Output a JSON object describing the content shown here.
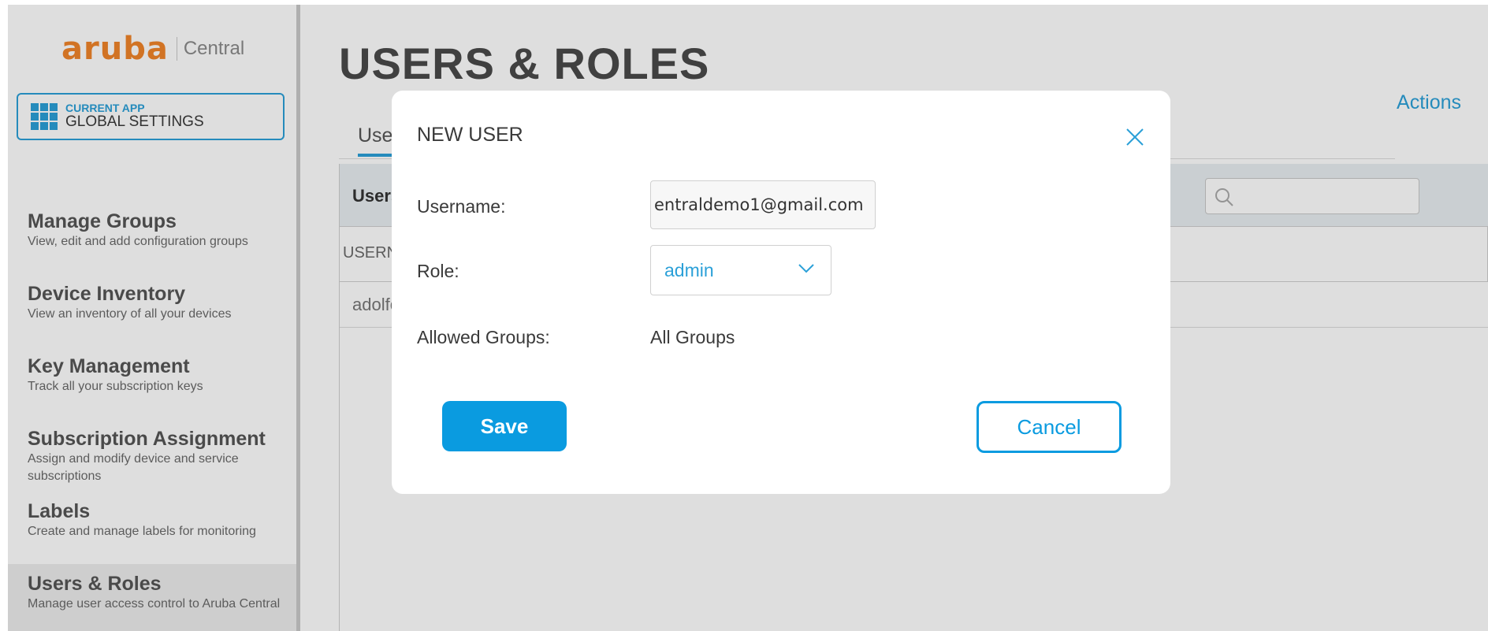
{
  "sidebar": {
    "logo_mark": "aruba",
    "logo_product": "Central",
    "app_switcher": {
      "caption": "CURRENT APP",
      "name": "GLOBAL SETTINGS"
    },
    "items": [
      {
        "title": "Manage Groups",
        "desc": "View, edit and add configuration groups"
      },
      {
        "title": "Device Inventory",
        "desc": "View an inventory of all your devices"
      },
      {
        "title": "Key Management",
        "desc": "Track all your subscription keys"
      },
      {
        "title": "Subscription Assignment",
        "desc": "Assign and modify device and service subscriptions"
      },
      {
        "title": "Labels",
        "desc": "Create and manage labels for monitoring"
      },
      {
        "title": "Users & Roles",
        "desc": "Manage user access control to Aruba Central"
      }
    ]
  },
  "main": {
    "title": "USERS & ROLES",
    "actions": "Actions",
    "tab_active": "Use",
    "panel_title": "Users",
    "col_header": "USERN",
    "row_first": "adolfc"
  },
  "modal": {
    "title": "NEW USER",
    "username_label": "Username:",
    "username_value": "entraldemo1@gmail.com",
    "role_label": "Role:",
    "role_value": "admin",
    "groups_label": "Allowed Groups:",
    "groups_value": "All Groups",
    "save_label": "Save",
    "cancel_label": "Cancel"
  },
  "colors": {
    "accent": "#2ba0d8",
    "primary_button": "#0a9be0",
    "brand_orange": "#f1852a"
  }
}
